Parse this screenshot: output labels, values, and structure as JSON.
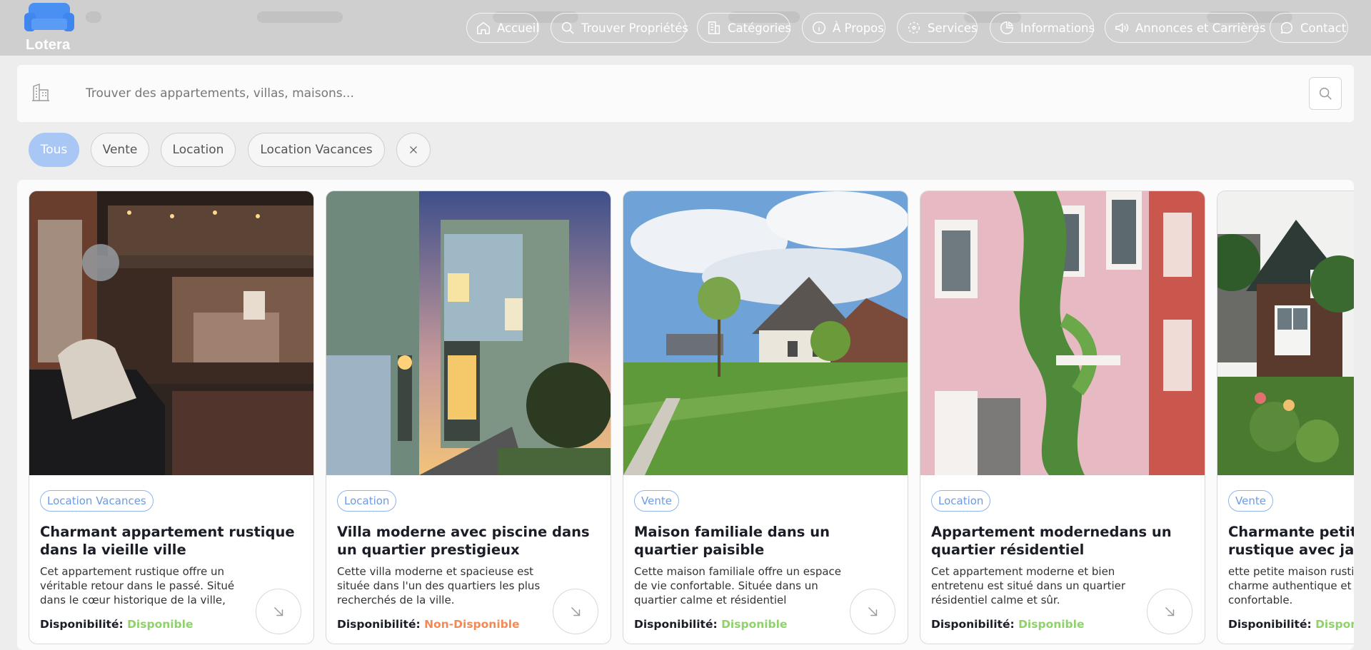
{
  "brand": {
    "name": "Lotera"
  },
  "nav": [
    {
      "label": "Accueil",
      "icon": "home-icon"
    },
    {
      "label": "Trouver Propriétés",
      "icon": "search-icon"
    },
    {
      "label": "Catégories",
      "icon": "building-icon"
    },
    {
      "label": "À Propos",
      "icon": "info-icon"
    },
    {
      "label": "Services",
      "icon": "services-icon"
    },
    {
      "label": "Informations",
      "icon": "pie-chart-icon"
    },
    {
      "label": "Annonces et Carrières",
      "icon": "megaphone-icon"
    },
    {
      "label": "Contact",
      "icon": "chat-icon"
    }
  ],
  "search": {
    "placeholder": "Trouver des appartements, villas, maisons...",
    "value": ""
  },
  "filters": {
    "chips": [
      "Tous",
      "Vente",
      "Location",
      "Location Vacances"
    ],
    "active": "Tous"
  },
  "availability_label": "Disponibilité:",
  "colors": {
    "accent": "#a9c7f5",
    "badge": "#6d9be0",
    "available": "#8ed26b",
    "unavailable": "#f08a57"
  },
  "cards": [
    {
      "category": "Location Vacances",
      "title": "Charmant appartement rustique dans la vieille ville",
      "description": "Cet appartement rustique offre un véritable retour dans le passé. Situé dans le cœur historique de la ville,",
      "availability": "Disponible",
      "image": "loft-interior"
    },
    {
      "category": "Location",
      "title": "Villa moderne avec piscine dans un quartier prestigieux",
      "description": "Cette villa moderne et spacieuse est située dans l'un des quartiers les plus recherchés de la ville.",
      "availability": "Non-Disponible",
      "image": "modern-villa-dusk"
    },
    {
      "category": "Vente",
      "title": "Maison familiale dans un quartier paisible",
      "description": "Cette maison familiale offre un espace de vie confortable. Située dans un quartier calme et résidentiel",
      "availability": "Disponible",
      "image": "suburban-house-lawn"
    },
    {
      "category": "Location",
      "title": "Appartement modernedans un quartier résidentiel",
      "description": "Cet appartement moderne et bien entretenu est situé dans un quartier résidentiel calme et sûr.",
      "availability": "Disponible",
      "image": "pink-facade-ivy"
    },
    {
      "category": "Vente",
      "title": "Charmante petite maison rustique avec jardin",
      "description": "ette petite maison rustique offre un charme authentique et une vie confortable.",
      "availability": "Disponible",
      "image": "brick-cottage-garden"
    }
  ]
}
